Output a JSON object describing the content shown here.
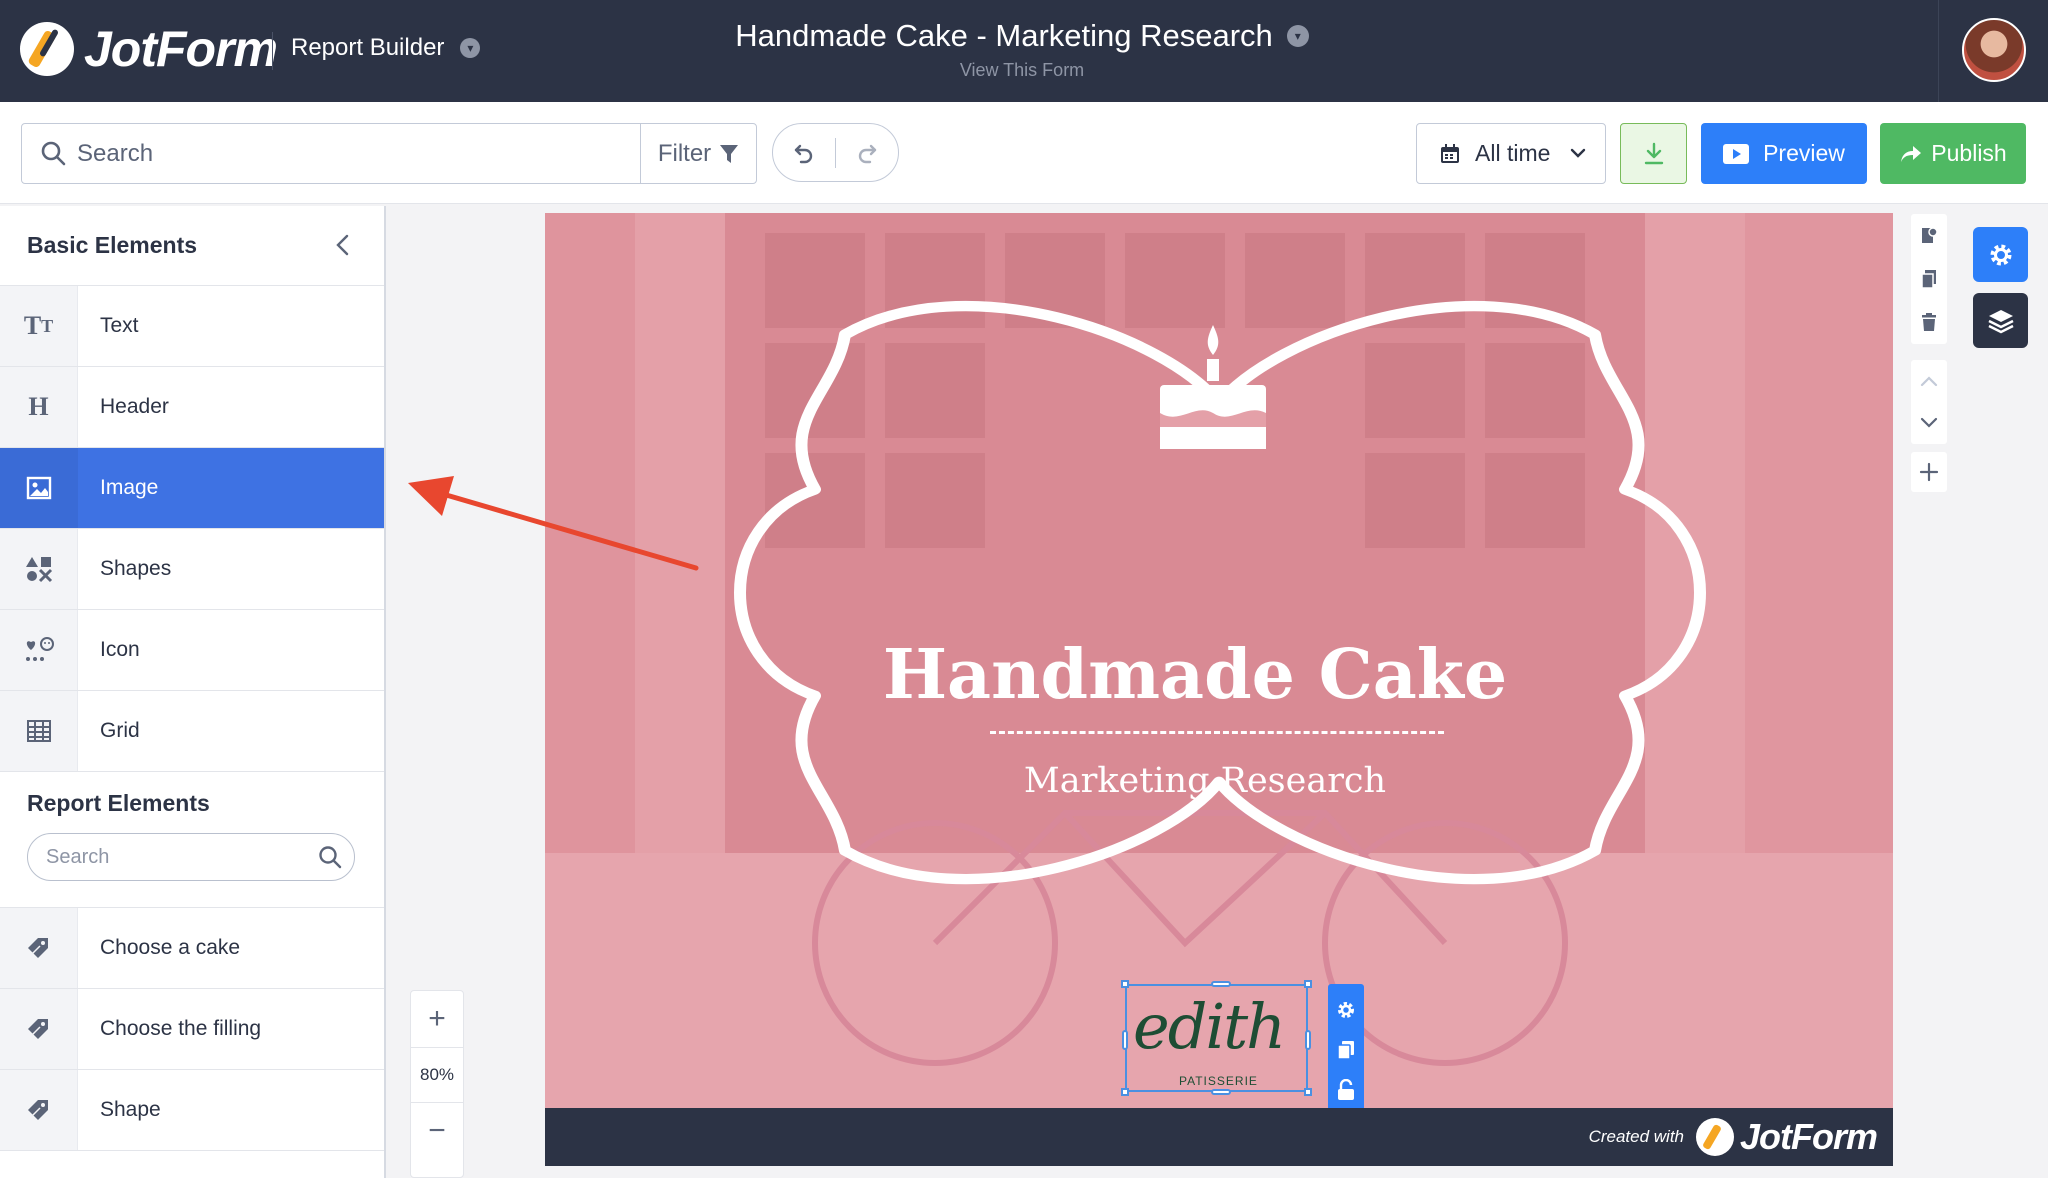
{
  "app": {
    "logo_text": "JotForm",
    "mode_label": "Report Builder",
    "title": "Handmade Cake - Marketing Research",
    "subtitle": "View This Form"
  },
  "toolbar": {
    "search_placeholder": "Search",
    "filter_label": "Filter",
    "date_range": "All time",
    "preview_label": "Preview",
    "publish_label": "Publish"
  },
  "sidebar": {
    "basic_title": "Basic Elements",
    "basic_items": [
      {
        "label": "Text",
        "icon": "text-icon"
      },
      {
        "label": "Header",
        "icon": "header-icon"
      },
      {
        "label": "Image",
        "icon": "image-icon",
        "active": true
      },
      {
        "label": "Shapes",
        "icon": "shapes-icon"
      },
      {
        "label": "Icon",
        "icon": "icon-library-icon"
      },
      {
        "label": "Grid",
        "icon": "grid-icon"
      }
    ],
    "report_title": "Report Elements",
    "report_search_placeholder": "Search",
    "report_items": [
      {
        "label": "Choose a cake",
        "icon": "tag-icon"
      },
      {
        "label": "Choose the filling",
        "icon": "tag-icon"
      },
      {
        "label": "Shape",
        "icon": "tag-icon"
      }
    ]
  },
  "canvas": {
    "heading": "Handmade Cake",
    "subheading": "Marketing Research",
    "logo_word": "edith",
    "logo_sub": "PATISSERIE",
    "footer_created": "Created with",
    "footer_brand": "JotForm",
    "zoom_level": "80%"
  },
  "colors": {
    "topbar": "#2c3345",
    "accent_blue": "#2d7ff9",
    "publish_green": "#4fb963",
    "sidebar_active": "#3e72e3",
    "page_pink": "#e39aa3",
    "annotation_arrow": "#e8472f"
  }
}
